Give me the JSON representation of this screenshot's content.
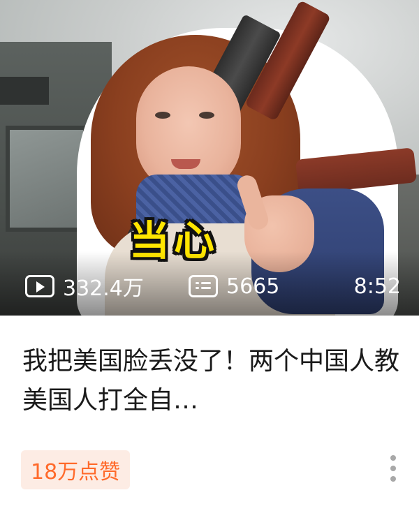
{
  "video_card": {
    "thumbnail": {
      "caption": "当心",
      "views": "332.4万",
      "danmaku_count": "5665",
      "duration": "8:52"
    },
    "title": "我把美国脸丢没了！两个中国人教美国人打全自…",
    "likes_badge": "18万点赞",
    "icons": {
      "views": "play-icon",
      "danmaku": "danmaku-icon",
      "more": "more-vertical-icon"
    },
    "colors": {
      "caption_fill": "#ffe600",
      "likes_text": "#ff6a2b",
      "likes_bg": "#fdece4",
      "title_text": "#1a1a1a"
    }
  }
}
